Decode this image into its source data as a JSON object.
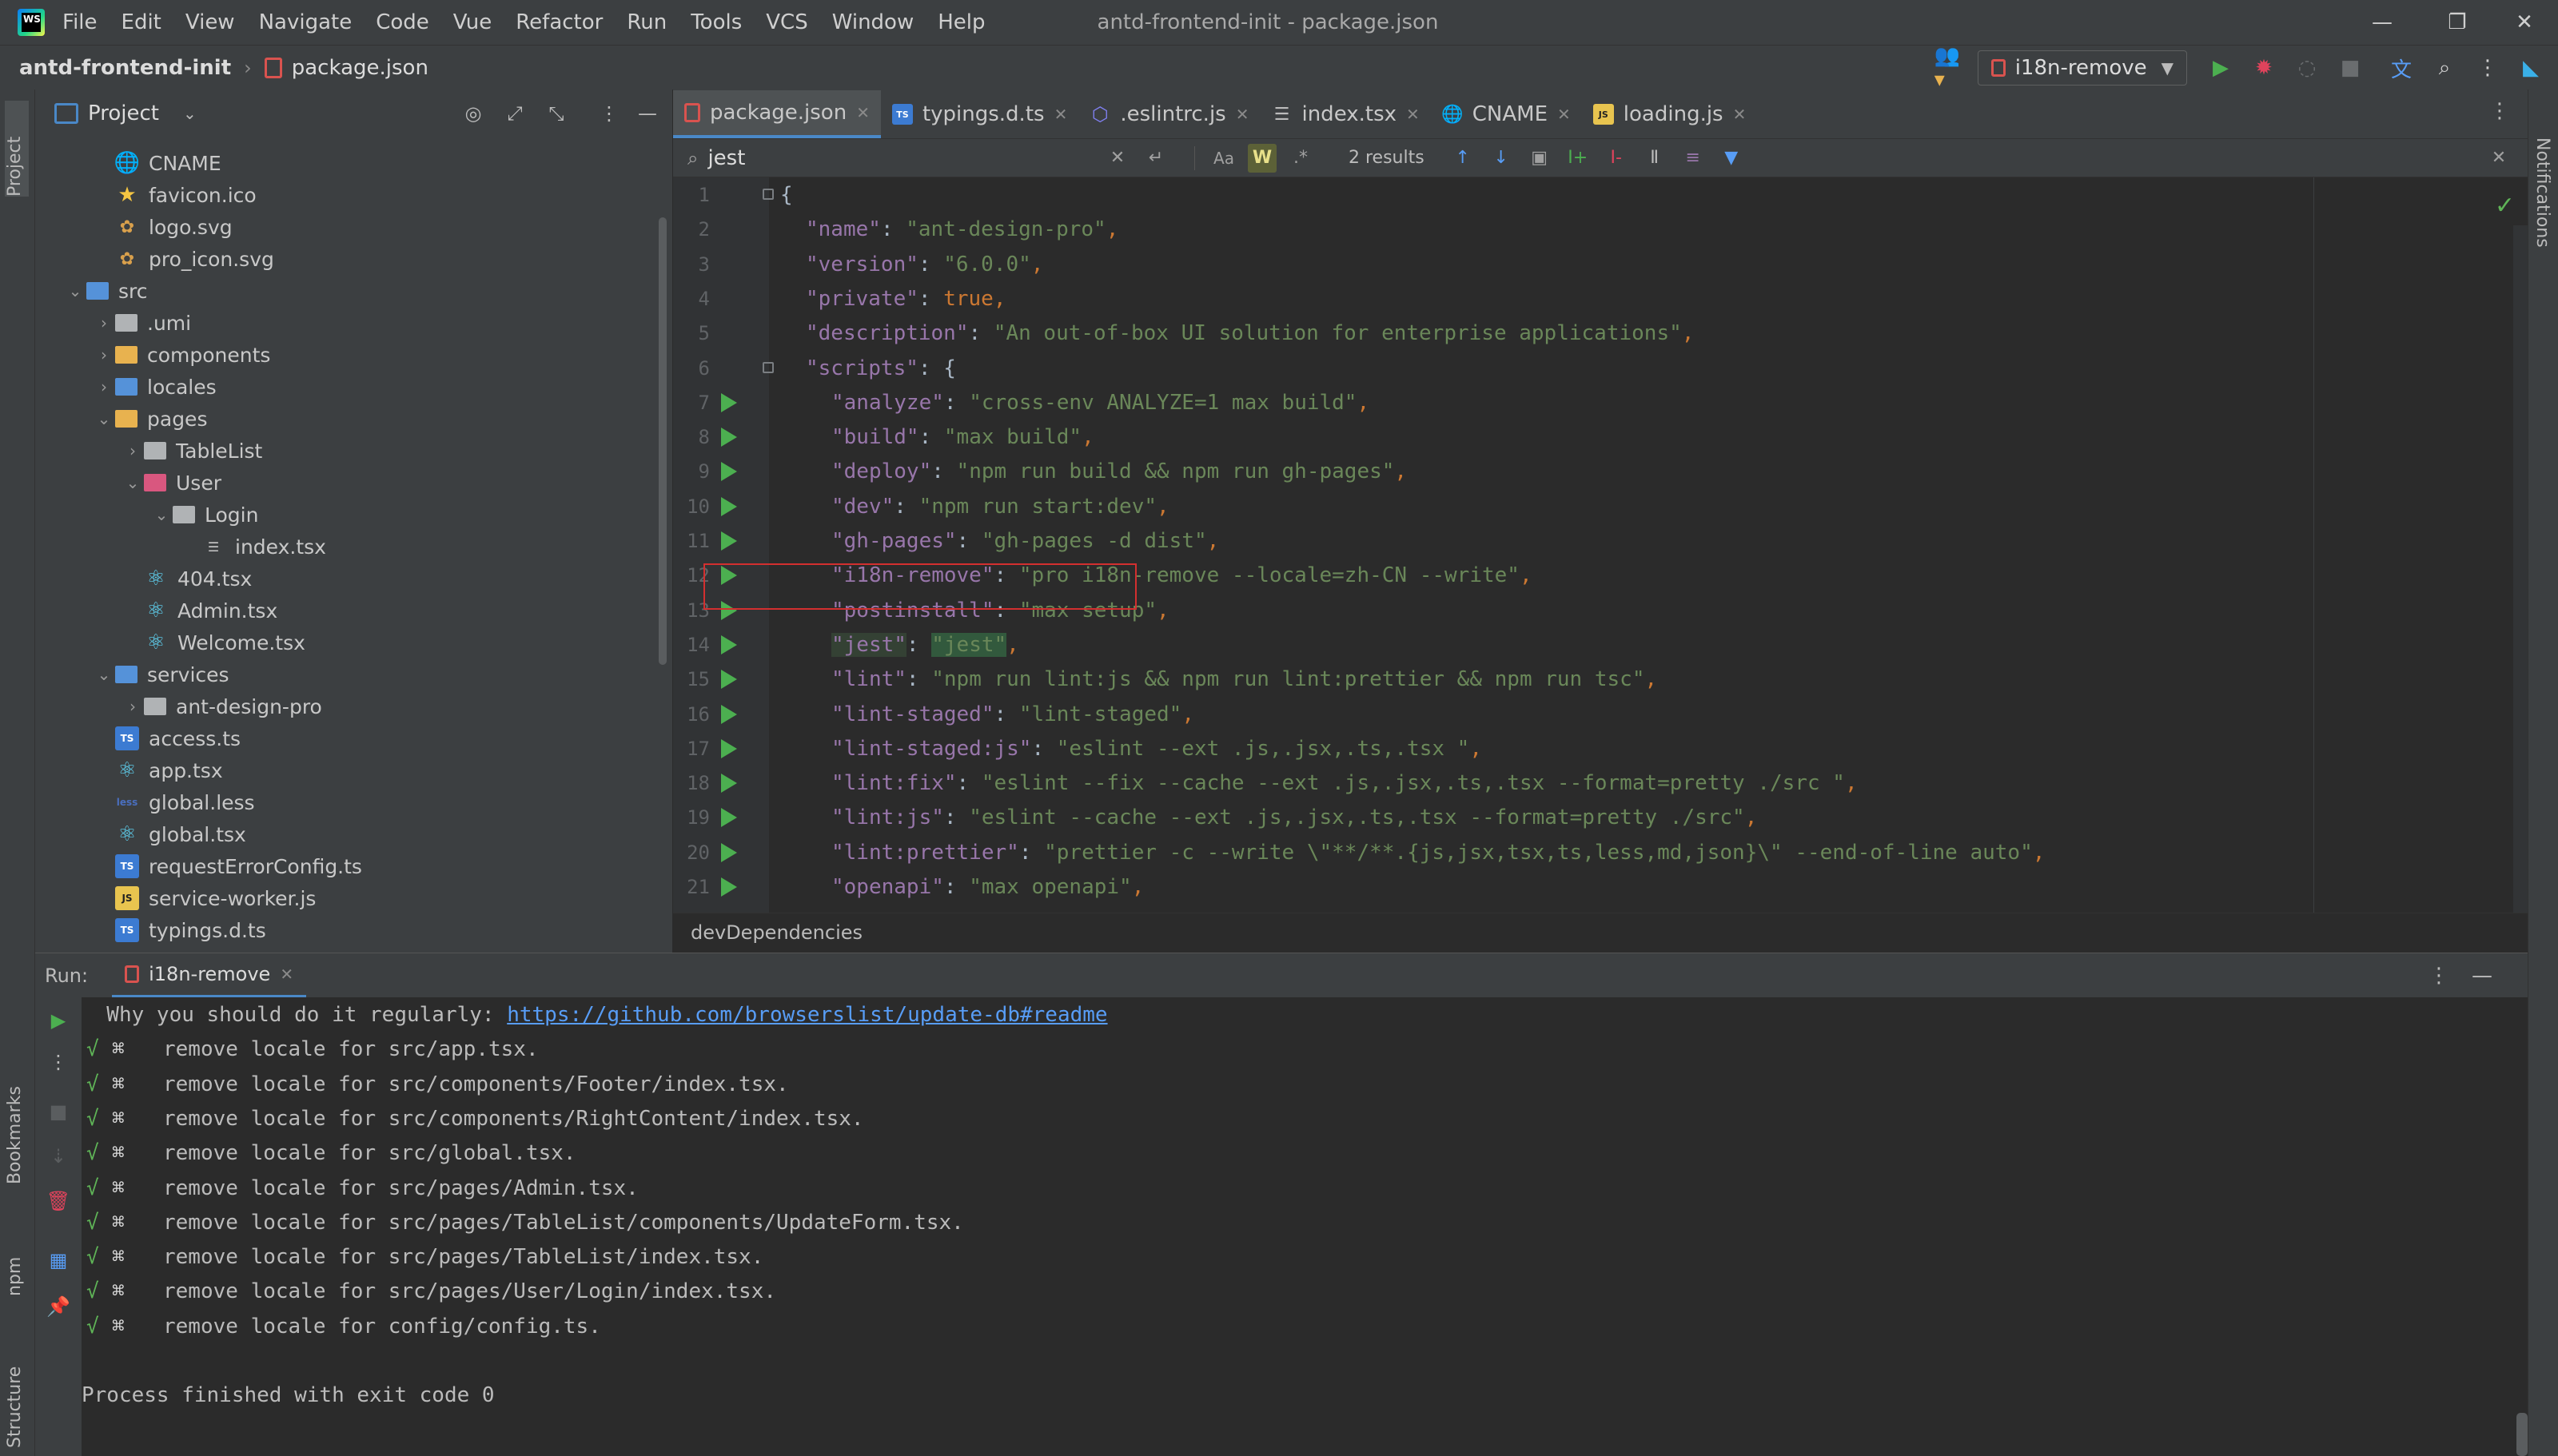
{
  "window": {
    "title": "antd-frontend-init - package.json",
    "menu": [
      "File",
      "Edit",
      "View",
      "Navigate",
      "Code",
      "Vue",
      "Refactor",
      "Run",
      "Tools",
      "VCS",
      "Window",
      "Help"
    ],
    "controls": {
      "minimize": "—",
      "restore": "❐",
      "close": "✕"
    }
  },
  "navbar": {
    "project": "antd-frontend-init",
    "file": "package.json",
    "run_config": "i18n-remove"
  },
  "project_panel": {
    "title": "Project",
    "tree": [
      {
        "label": "CNAME",
        "icon": "globe-icon",
        "depth": 2
      },
      {
        "label": "favicon.ico",
        "icon": "star-icon",
        "depth": 2
      },
      {
        "label": "logo.svg",
        "icon": "svg-icon",
        "depth": 2
      },
      {
        "label": "pro_icon.svg",
        "icon": "svg-icon",
        "depth": 2
      },
      {
        "label": "src",
        "icon": "folder-blue",
        "depth": 1,
        "chev": "⌄"
      },
      {
        "label": ".umi",
        "icon": "folder",
        "depth": 2,
        "chev": "›"
      },
      {
        "label": "components",
        "icon": "folder-yellow",
        "depth": 2,
        "chev": "›"
      },
      {
        "label": "locales",
        "icon": "folder-blue",
        "depth": 2,
        "chev": "›"
      },
      {
        "label": "pages",
        "icon": "folder-yellow",
        "depth": 2,
        "chev": "⌄"
      },
      {
        "label": "TableList",
        "icon": "folder",
        "depth": 3,
        "chev": "›"
      },
      {
        "label": "User",
        "icon": "folder-pink",
        "depth": 3,
        "chev": "⌄"
      },
      {
        "label": "Login",
        "icon": "folder",
        "depth": 4,
        "chev": "⌄"
      },
      {
        "label": "index.tsx",
        "icon": "list-icon",
        "depth": 5
      },
      {
        "label": "404.tsx",
        "icon": "react-icon",
        "depth": 3
      },
      {
        "label": "Admin.tsx",
        "icon": "react-icon",
        "depth": 3
      },
      {
        "label": "Welcome.tsx",
        "icon": "react-icon",
        "depth": 3
      },
      {
        "label": "services",
        "icon": "folder-blue",
        "depth": 2,
        "chev": "⌄"
      },
      {
        "label": "ant-design-pro",
        "icon": "folder",
        "depth": 3,
        "chev": "›"
      },
      {
        "label": "access.ts",
        "icon": "ts-icon",
        "depth": 2
      },
      {
        "label": "app.tsx",
        "icon": "react-icon",
        "depth": 2
      },
      {
        "label": "global.less",
        "icon": "less-icon",
        "depth": 2
      },
      {
        "label": "global.tsx",
        "icon": "react-icon",
        "depth": 2
      },
      {
        "label": "requestErrorConfig.ts",
        "icon": "ts-icon",
        "depth": 2
      },
      {
        "label": "service-worker.js",
        "icon": "js-icon",
        "depth": 2
      },
      {
        "label": "typings.d.ts",
        "icon": "ts-icon",
        "depth": 2
      }
    ]
  },
  "editor_tabs": [
    {
      "label": "package.json",
      "icon": "json-icon",
      "active": true
    },
    {
      "label": "typings.d.ts",
      "icon": "ts-icon"
    },
    {
      "label": ".eslintrc.js",
      "icon": "eslint-icon"
    },
    {
      "label": "index.tsx",
      "icon": "list-icon"
    },
    {
      "label": "CNAME",
      "icon": "globe-icon"
    },
    {
      "label": "loading.js",
      "icon": "js-icon"
    }
  ],
  "find": {
    "query": "jest",
    "results": "2 results",
    "match_case": "Aa",
    "words": "W",
    "regex": ".*"
  },
  "code_lines": [
    {
      "n": "1",
      "text": "{"
    },
    {
      "n": "2",
      "key": "\"name\"",
      "val": "\"ant-design-pro\"",
      "indent": 1
    },
    {
      "n": "3",
      "key": "\"version\"",
      "val": "\"6.0.0\"",
      "indent": 1
    },
    {
      "n": "4",
      "key": "\"private\"",
      "bool": "true",
      "indent": 1
    },
    {
      "n": "5",
      "key": "\"description\"",
      "val": "\"An out-of-box UI solution for enterprise applications\"",
      "indent": 1
    },
    {
      "n": "6",
      "key": "\"scripts\"",
      "obj": "{",
      "indent": 1
    },
    {
      "n": "7",
      "key": "\"analyze\"",
      "val": "\"cross-env ANALYZE=1 max build\"",
      "indent": 2,
      "run": true
    },
    {
      "n": "8",
      "key": "\"build\"",
      "val": "\"max build\"",
      "indent": 2,
      "run": true
    },
    {
      "n": "9",
      "key": "\"deploy\"",
      "val": "\"npm run build && npm run gh-pages\"",
      "indent": 2,
      "run": true
    },
    {
      "n": "10",
      "key": "\"dev\"",
      "val": "\"npm run start:dev\"",
      "indent": 2,
      "run": true
    },
    {
      "n": "11",
      "key": "\"gh-pages\"",
      "val": "\"gh-pages -d dist\"",
      "indent": 2,
      "run": true
    },
    {
      "n": "12",
      "key": "\"i18n-remove\"",
      "val": "\"pro i18n-remove --locale=zh-CN --write\"",
      "indent": 2,
      "run": true
    },
    {
      "n": "13",
      "key": "\"postinstall\"",
      "val": "\"max setup\"",
      "indent": 2,
      "run": true
    },
    {
      "n": "14",
      "key": "\"jest\"",
      "val": "\"jest\"",
      "indent": 2,
      "run": true,
      "highlight": true
    },
    {
      "n": "15",
      "key": "\"lint\"",
      "val": "\"npm run lint:js && npm run lint:prettier && npm run tsc\"",
      "indent": 2,
      "run": true
    },
    {
      "n": "16",
      "key": "\"lint-staged\"",
      "val": "\"lint-staged\"",
      "indent": 2,
      "run": true
    },
    {
      "n": "17",
      "key": "\"lint-staged:js\"",
      "val": "\"eslint --ext .js,.jsx,.ts,.tsx \"",
      "indent": 2,
      "run": true
    },
    {
      "n": "18",
      "key": "\"lint:fix\"",
      "val": "\"eslint --fix --cache --ext .js,.jsx,.ts,.tsx --format=pretty ./src \"",
      "indent": 2,
      "run": true
    },
    {
      "n": "19",
      "key": "\"lint:js\"",
      "val": "\"eslint --cache --ext .js,.jsx,.ts,.tsx --format=pretty ./src\"",
      "indent": 2,
      "run": true
    },
    {
      "n": "20",
      "key": "\"lint:prettier\"",
      "val": "\"prettier -c --write \\\"**/**.{js,jsx,tsx,ts,less,md,json}\\\" --end-of-line auto\"",
      "indent": 2,
      "run": true
    },
    {
      "n": "21",
      "key": "\"openapi\"",
      "val": "\"max openapi\"",
      "indent": 2,
      "run": true
    }
  ],
  "editor_breadcrumb": "devDependencies",
  "run_panel": {
    "label": "Run:",
    "tab": "i18n-remove",
    "console": [
      {
        "type": "text",
        "prefix": "  Why you should do it regularly: ",
        "link": "https://github.com/browserslist/update-db#readme"
      },
      {
        "type": "ok",
        "text": "remove locale for src/app.tsx."
      },
      {
        "type": "ok",
        "text": "remove locale for src/components/Footer/index.tsx."
      },
      {
        "type": "ok",
        "text": "remove locale for src/components/RightContent/index.tsx."
      },
      {
        "type": "ok",
        "text": "remove locale for src/global.tsx."
      },
      {
        "type": "ok",
        "text": "remove locale for src/pages/Admin.tsx."
      },
      {
        "type": "ok",
        "text": "remove locale for src/pages/TableList/components/UpdateForm.tsx."
      },
      {
        "type": "ok",
        "text": "remove locale for src/pages/TableList/index.tsx."
      },
      {
        "type": "ok",
        "text": "remove locale for src/pages/User/Login/index.tsx."
      },
      {
        "type": "ok",
        "text": "remove locale for config/config.ts."
      },
      {
        "type": "blank",
        "text": ""
      },
      {
        "type": "text",
        "prefix": "Process finished with exit code 0"
      }
    ],
    "tick": "√",
    "cmd_glyph": "⌘"
  },
  "side_tabs": {
    "project": "Project",
    "bookmarks": "Bookmarks",
    "npm": "npm",
    "structure": "Structure",
    "notifications": "Notifications"
  },
  "colors": {
    "accent": "#4a88c7",
    "run_green": "#4caf50",
    "debug_red": "#e0435c",
    "highlight_box": "#d32f2f"
  }
}
